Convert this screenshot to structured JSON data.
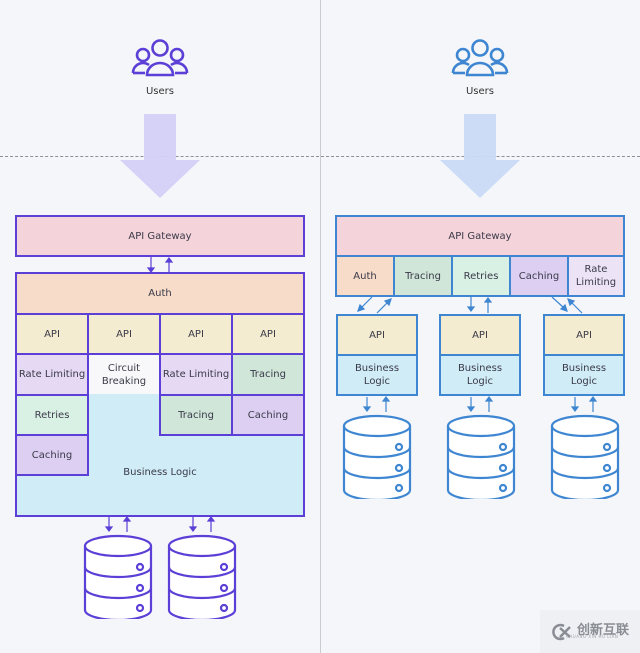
{
  "left": {
    "users_label": "Users",
    "gateway": "API Gateway",
    "auth": "Auth",
    "apis": [
      "API",
      "API",
      "API",
      "API"
    ],
    "row2": [
      "Rate Limiting",
      "Circuit Breaking",
      "Rate Limiting",
      "Tracing"
    ],
    "retries": "Retries",
    "tracing2": "Tracing",
    "caching_right": "Caching",
    "caching_left": "Caching",
    "business_logic": "Business Logic",
    "databases": 2
  },
  "right": {
    "users_label": "Users",
    "gateway": "API Gateway",
    "gateway_modules": [
      "Auth",
      "Tracing",
      "Retries",
      "Caching",
      "Rate Limiting"
    ],
    "services": [
      {
        "api": "API",
        "logic": "Business Logic"
      },
      {
        "api": "API",
        "logic": "Business Logic"
      },
      {
        "api": "API",
        "logic": "Business Logic"
      }
    ]
  },
  "colors": {
    "left_stroke": "#5b3fd6",
    "right_stroke": "#3e86d1",
    "left_arrow_fill": "#d4d0f7",
    "right_arrow_fill": "#c9daf6"
  },
  "watermark": {
    "text": "创新互联",
    "sub": "CHUANG XIN HU LIAN"
  }
}
